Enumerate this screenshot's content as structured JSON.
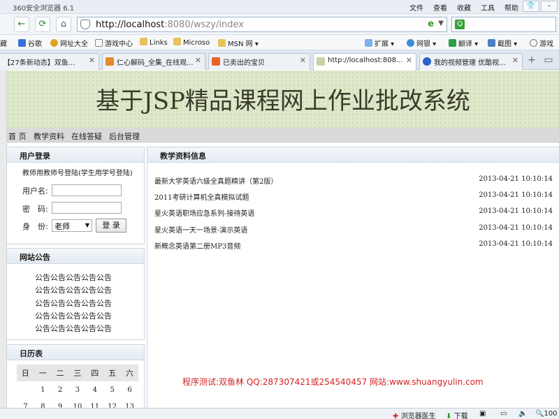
{
  "browser": {
    "title": "360安全浏览器 6.1",
    "menus": [
      "文件",
      "查看",
      "收藏",
      "工具",
      "帮助"
    ],
    "url_host": "http://localhost",
    "url_path": ":8080/wszy/index",
    "favorites_cut": "藏",
    "favorites": [
      "谷歌",
      "网址大全",
      "游戏中心",
      "Links",
      "Microso",
      "MSN 网"
    ],
    "ext": [
      "扩展",
      "网银",
      "翻译",
      "截图",
      "游戏"
    ],
    "tabs": [
      "【27条新动态】双鱼...",
      "仁心解码_全集_在线观...",
      "已卖出的宝贝",
      "http://localhost:808...",
      "我的视频管理 优酷视..."
    ],
    "status": [
      "浏览器医生",
      "下载",
      "100"
    ]
  },
  "site": {
    "title": "基于JSP精品课程网上作业批改系统",
    "nav": [
      "首 页",
      "教学资料",
      "在线答疑",
      "后台管理"
    ]
  },
  "login": {
    "header": "用户登录",
    "note": "教师用教师号登陆(学生用学号登陆)",
    "user_label": "用户名:",
    "pwd_label": "密　码:",
    "role_label": "身　份:",
    "role_value": "老师",
    "submit": "登 录"
  },
  "notice": {
    "header": "网站公告",
    "lines": [
      "公告公告公告公告公告",
      "公告公告公告公告公告",
      "公告公告公告公告公告",
      "公告公告公告公告公告",
      "公告公告公告公告公告"
    ]
  },
  "calendar": {
    "header": "日历表",
    "weekdays": [
      "日",
      "一",
      "二",
      "三",
      "四",
      "五",
      "六"
    ],
    "rows": [
      [
        "",
        "1",
        "2",
        "3",
        "4",
        "5",
        "6"
      ],
      [
        "7",
        "8",
        "9",
        "10",
        "11",
        "12",
        "13"
      ]
    ]
  },
  "materials": {
    "header": "教学资料信息",
    "items": [
      {
        "title": "最新大学英语六级全真题精讲（第2版）",
        "date": "2013-04-21 10:10:14"
      },
      {
        "title": "2011考研计算机全真模拟试题",
        "date": "2013-04-21 10:10:14"
      },
      {
        "title": "星火英语职场应急系列-接待英语",
        "date": "2013-04-21 10:10:14"
      },
      {
        "title": "星火英语一天一场景-演示英语",
        "date": "2013-04-21 10:10:14"
      },
      {
        "title": "新概念英语第二册MP3音频",
        "date": "2013-04-21 10:10:14"
      }
    ]
  },
  "credit": "程序测试:双鱼林 QQ:287307421或254540457 网站:www.shuangyulin.com"
}
